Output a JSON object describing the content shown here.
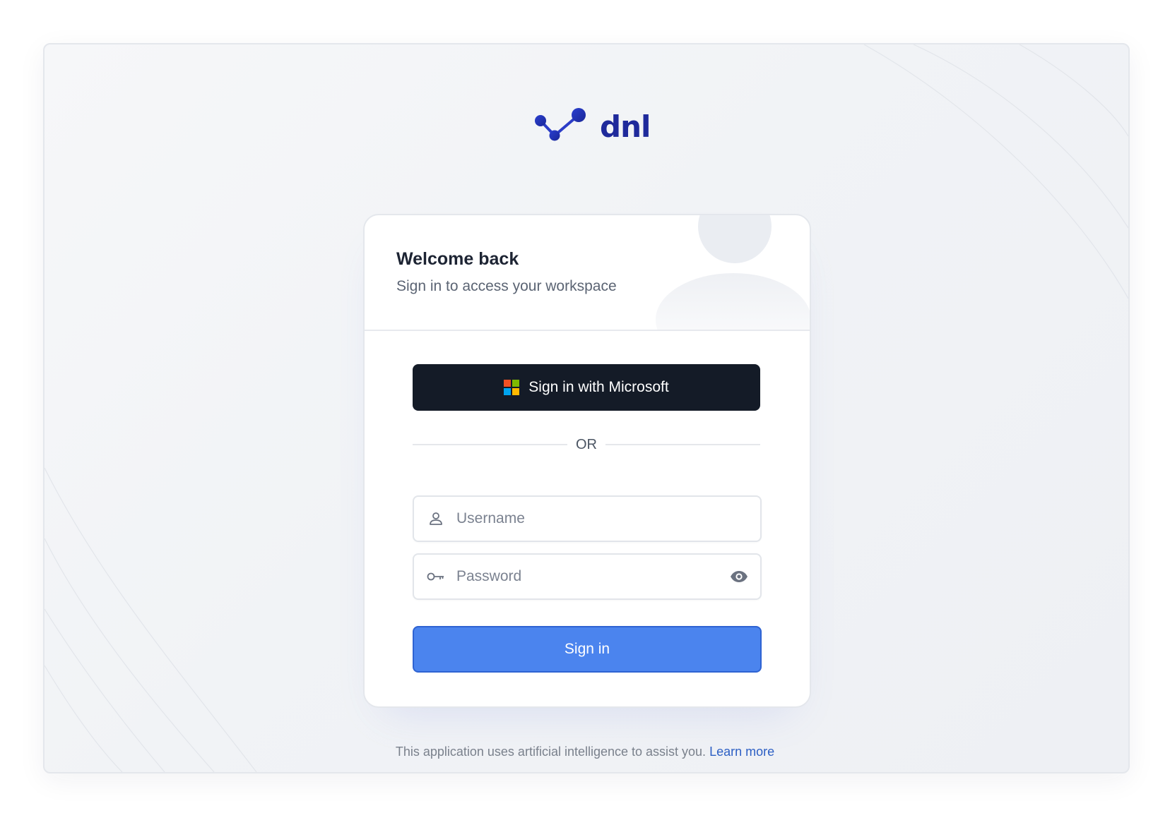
{
  "brand": {
    "name": "dnl",
    "logo_icon": "molecule-check-icon",
    "color": "#1f2a9b"
  },
  "login": {
    "title": "Welcome back",
    "subtitle": "Sign in to access your workspace",
    "microsoft_button_label": "Sign in with Microsoft",
    "divider_text": "OR",
    "username_placeholder": "Username",
    "password_placeholder": "Password",
    "submit_label": "Sign in"
  },
  "footer": {
    "notice": "This application uses artificial intelligence to assist you.",
    "link_text": "Learn more"
  },
  "colors": {
    "primary_button": "#4b84ee",
    "microsoft_button": "#141b27",
    "link": "#2c5fc4",
    "ms_red": "#f25022",
    "ms_green": "#7fba00",
    "ms_blue": "#00a4ef",
    "ms_yellow": "#ffb900"
  },
  "icons": {
    "username_field": "user-icon",
    "password_field": "key-icon",
    "password_toggle": "eye-icon",
    "microsoft": "microsoft-logo-icon"
  }
}
